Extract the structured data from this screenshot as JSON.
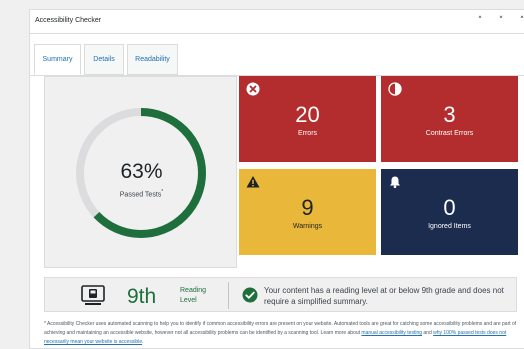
{
  "panel": {
    "title": "Accessibility Checker",
    "collapse_up_icon": "⌃",
    "collapse_down_icon": "⌄",
    "more_icon": "⌃"
  },
  "tabs": [
    {
      "label": "Summary",
      "active": true
    },
    {
      "label": "Details",
      "active": false
    },
    {
      "label": "Readability",
      "active": false
    }
  ],
  "score": {
    "percent_text": "63%",
    "percent_value": 63,
    "label": "Passed Tests",
    "footnote_marker": "*",
    "ring_color": "#1e6f3b",
    "track_color": "#dcdcde"
  },
  "tiles": {
    "errors": {
      "count": "20",
      "label": "Errors",
      "color": "#b32d2e",
      "icon": "x-circle-icon"
    },
    "contrast": {
      "count": "3",
      "label": "Contrast Errors",
      "color": "#b32d2e",
      "icon": "half-circle-icon"
    },
    "warnings": {
      "count": "9",
      "label": "Warnings",
      "color": "#e9b83a",
      "icon": "warning-triangle-icon"
    },
    "ignored": {
      "count": "0",
      "label": "Ignored Items",
      "color": "#1c2c4f",
      "icon": "bell-icon"
    }
  },
  "reading": {
    "grade": "9th",
    "label_line1": "Reading",
    "label_line2": "Level",
    "message": "Your content has a reading level at or below 9th grade and does not require a simplified summary."
  },
  "footnote": {
    "text_before": "* Accessibility Checker uses automated scanning to help you to identify if common accessibility errors are present on your website. Automated tools are great for catching some accessibility problems and are part of achieving and maintaining an accessible website, however not all accessibility problems can be identified by a scanning tool. Learn more about ",
    "link1": "manual accessibility testing",
    "text_middle": " and ",
    "link2": "why 100% passed tests does not necessarily mean your website is accessible",
    "text_after": "."
  }
}
